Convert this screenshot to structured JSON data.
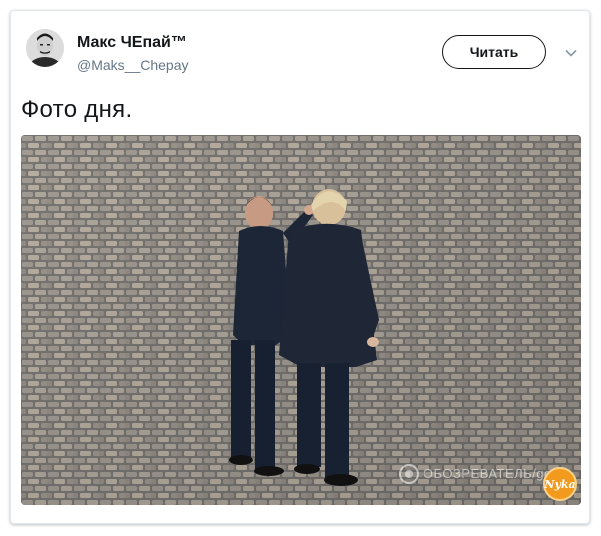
{
  "tweet": {
    "display_name": "Макс ЧЕпай™",
    "handle": "@Maks__Chepay",
    "follow_label": "Читать",
    "text": "Фото дня.",
    "photo": {
      "watermark": "ОБОЗРЕВАТЕЛЬ/getty",
      "logo": "Nyka"
    }
  },
  "icons": [
    "avatar",
    "chevron-down-icon",
    "camera-icon"
  ]
}
